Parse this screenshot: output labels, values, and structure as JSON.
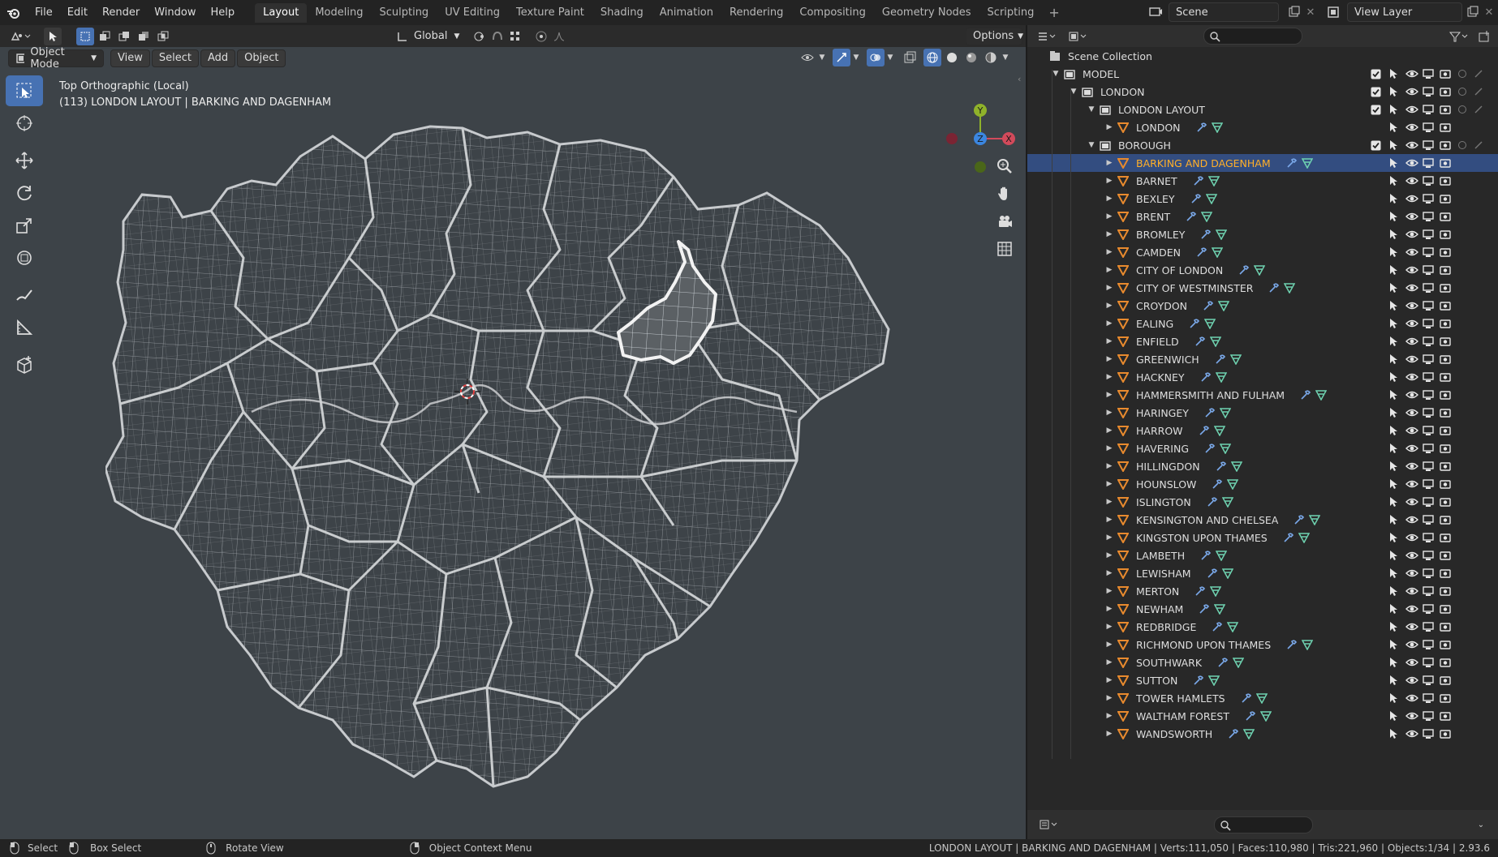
{
  "menu": {
    "items": [
      "File",
      "Edit",
      "Render",
      "Window",
      "Help"
    ]
  },
  "workspaces": {
    "tabs": [
      "Layout",
      "Modeling",
      "Sculpting",
      "UV Editing",
      "Texture Paint",
      "Shading",
      "Animation",
      "Rendering",
      "Compositing",
      "Geometry Nodes",
      "Scripting"
    ],
    "active": "Layout"
  },
  "scene": {
    "name": "Scene",
    "view_layer": "View Layer"
  },
  "viewport": {
    "mode": "Object Mode",
    "menus": [
      "View",
      "Select",
      "Add",
      "Object"
    ],
    "transform_orientation": "Global",
    "options_label": "Options",
    "view_name": "Top Orthographic (Local)",
    "object_info": "(113) LONDON LAYOUT | BARKING AND DAGENHAM",
    "gizmo": {
      "x": "X",
      "y": "Y",
      "z": "Z"
    }
  },
  "outliner": {
    "root": "Scene Collection",
    "collections": [
      {
        "name": "MODEL"
      },
      {
        "name": "LONDON"
      },
      {
        "name": "LONDON LAYOUT"
      },
      {
        "name": "LONDON"
      },
      {
        "name": "BOROUGH"
      }
    ],
    "boroughs": [
      "BARKING AND DAGENHAM",
      "BARNET",
      "BEXLEY",
      "BRENT",
      "BROMLEY",
      "CAMDEN",
      "CITY OF LONDON",
      "CITY OF WESTMINSTER",
      "CROYDON",
      "EALING",
      "ENFIELD",
      "GREENWICH",
      "HACKNEY",
      "HAMMERSMITH AND FULHAM",
      "HARINGEY",
      "HARROW",
      "HAVERING",
      "HILLINGDON",
      "HOUNSLOW",
      "ISLINGTON",
      "KENSINGTON AND CHELSEA",
      "KINGSTON UPON THAMES",
      "LAMBETH",
      "LEWISHAM",
      "MERTON",
      "NEWHAM",
      "REDBRIDGE",
      "RICHMOND UPON THAMES",
      "SOUTHWARK",
      "SUTTON",
      "TOWER HAMLETS",
      "WALTHAM FOREST",
      "WANDSWORTH"
    ],
    "selected": "BARKING AND DAGENHAM"
  },
  "statusbar": {
    "select": "Select",
    "box_select": "Box Select",
    "rotate": "Rotate View",
    "context": "Object Context Menu",
    "stats": "LONDON LAYOUT | BARKING AND DAGENHAM | Verts:111,050 | Faces:110,980 | Tris:221,960 | Objects:1/34 | 2.93.6"
  },
  "colors": {
    "accent": "#4772b3",
    "selected_text": "#ffaf29",
    "mesh_icon": "#e88a2e",
    "wire": "#b9bcbf",
    "bg": "#3d4348"
  }
}
